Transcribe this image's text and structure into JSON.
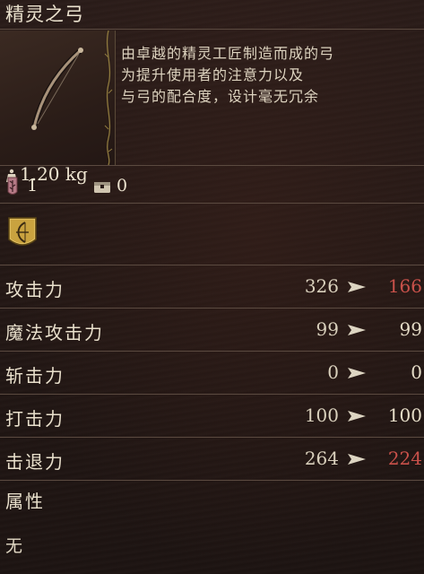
{
  "item": {
    "name": "精灵之弓",
    "description": [
      "由卓越的精灵工匠制造而成的弓",
      "为提升使用者的注意力以及",
      "与弓的配合度，设计毫无冗余"
    ],
    "weight": "1.20 kg",
    "image_icon": "bow-icon"
  },
  "requirements": {
    "attack_cost": "1",
    "storage": "0",
    "attack_icon": "feather-shield-icon",
    "storage_icon": "chest-icon"
  },
  "badge": {
    "icon": "bow-emblem-icon"
  },
  "stats": [
    {
      "name": "攻击力",
      "current": "326",
      "new": "166",
      "trend": "down"
    },
    {
      "name": "魔法攻击力",
      "current": "99",
      "new": "99",
      "trend": "same"
    },
    {
      "name": "斩击力",
      "current": "0",
      "new": "0",
      "trend": "same"
    },
    {
      "name": "打击力",
      "current": "100",
      "new": "100",
      "trend": "same"
    },
    {
      "name": "击退力",
      "current": "264",
      "new": "224",
      "trend": "down"
    }
  ],
  "attribute": {
    "label": "属性",
    "value": "无"
  },
  "colors": {
    "decrease": "#c9514a",
    "text": "#e6ddc8",
    "divider": "#5b4a40",
    "gold": "#c9a23f"
  }
}
